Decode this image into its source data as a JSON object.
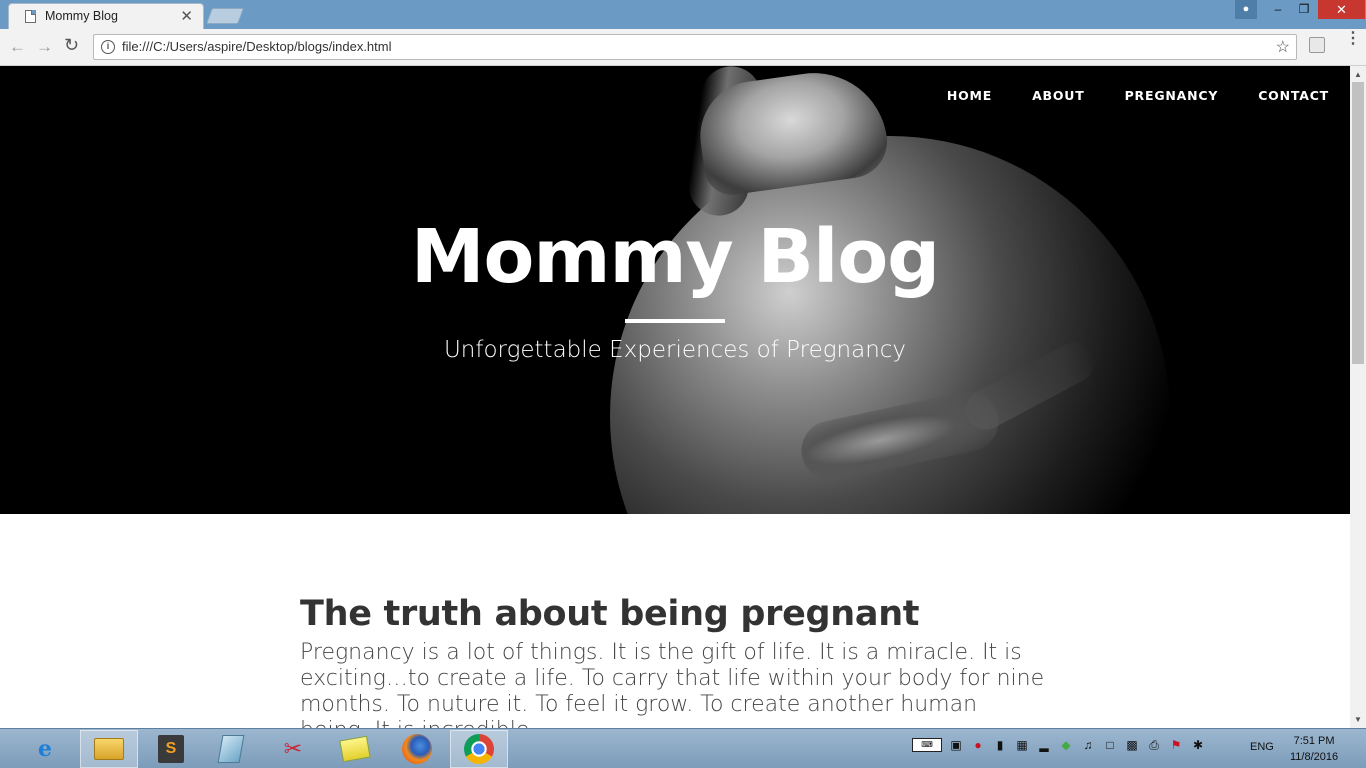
{
  "browser": {
    "tab_title": "Mommy Blog",
    "tab_close": "✕",
    "url": "file:///C:/Users/aspire/Desktop/blogs/index.html"
  },
  "window_controls": {
    "minimize": "–",
    "restore": "❐",
    "close": "✕"
  },
  "page": {
    "nav": [
      "HOME",
      "ABOUT",
      "PREGNANCY",
      "CONTACT"
    ],
    "hero_title": "Mommy Blog",
    "hero_subtitle": "Unforgettable Experiences of Pregnancy",
    "post_title": "The truth about being pregnant",
    "post_body": "Pregnancy is a lot of things. It is the gift of life. It is a miracle. It is exciting…to create a life. To carry that life within your body for nine months. To nuture it. To feel it grow. To create another human being. It is incredible."
  },
  "taskbar": {
    "apps": [
      "internet-explorer",
      "file-explorer",
      "sublime-text",
      "app-4",
      "snipping-tool",
      "sticky-notes",
      "firefox",
      "chrome"
    ],
    "sublime_glyph": "S",
    "ie_glyph": "e",
    "language": "ENG",
    "time": "7:51 PM",
    "date": "11/8/2016"
  },
  "colors": {
    "titlebar": "#6b9bc4",
    "hero_bg": "#000000",
    "heading_text": "#333333",
    "close_button": "#c7372f"
  }
}
